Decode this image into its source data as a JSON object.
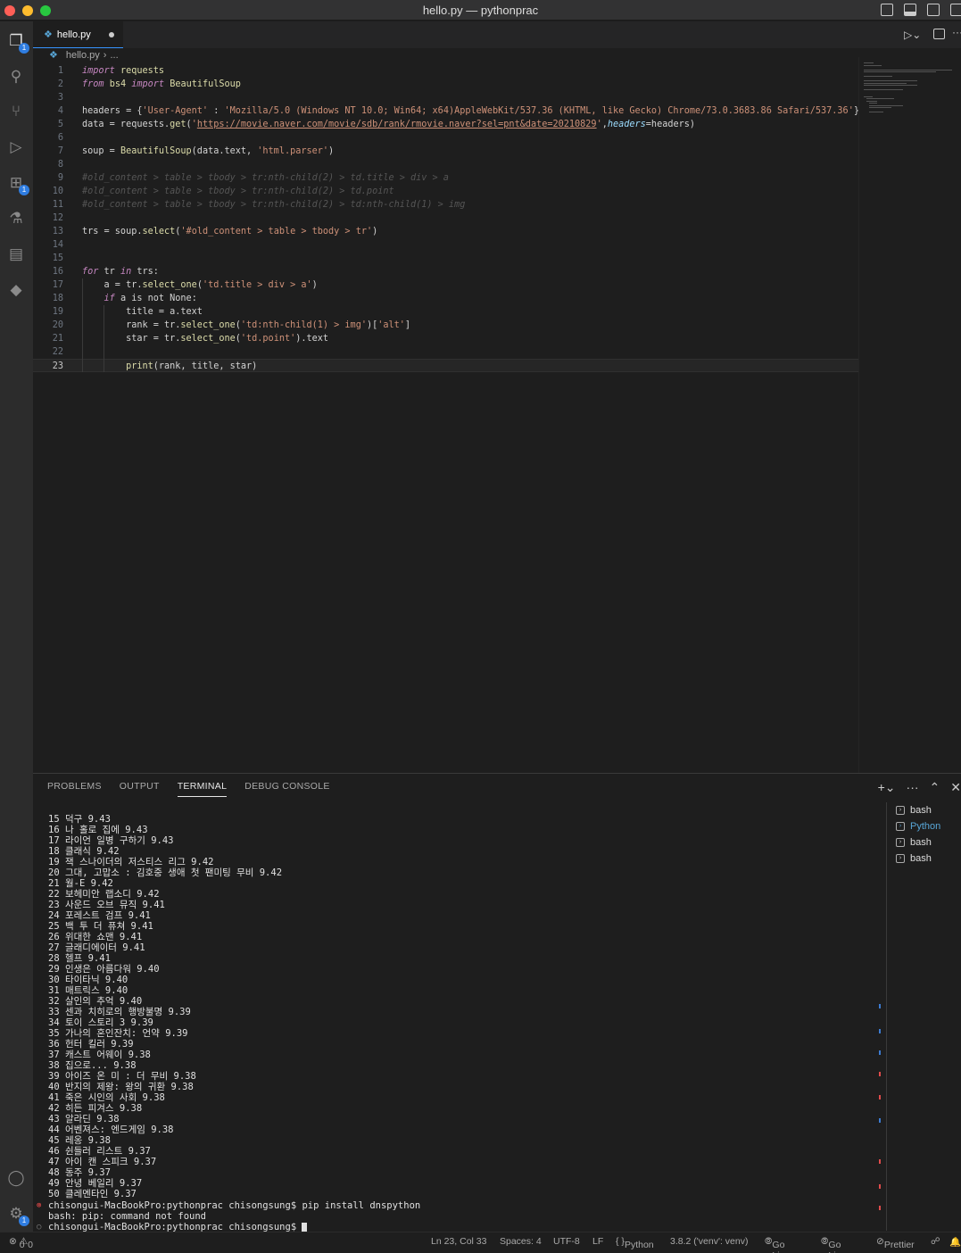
{
  "window": {
    "title": "hello.py — pythonprac"
  },
  "activity_bar": {
    "explorer_badge": "1",
    "extensions_badge": "1",
    "settings_badge": "1"
  },
  "tab": {
    "filename": "hello.py"
  },
  "breadcrumb": {
    "file": "hello.py",
    "more": "..."
  },
  "code": [
    {
      "n": "1",
      "html": "<span class='kw'>import</span> <span class='fn'>requests</span>"
    },
    {
      "n": "2",
      "html": "<span class='kw'>from</span> <span class='fn'>bs4</span> <span class='kw'>import</span> <span class='fn'>BeautifulSoup</span>"
    },
    {
      "n": "3",
      "html": ""
    },
    {
      "n": "4",
      "html": "headers = {<span class='st'>'User-Agent'</span> : <span class='st'>'Mozilla/5.0 (Windows NT 10.0; Win64; x64)AppleWebKit/537.36 (KHTML, like Gecko) Chrome/73.0.3683.86 Safari/537.36'</span>}"
    },
    {
      "n": "5",
      "html": "data = requests.<span class='fn'>get</span>(<span class='st'>'</span><span class='url'>https://movie.naver.com/movie/sdb/rank/rmovie.naver?sel=pnt&amp;date=20210829</span><span class='st'>'</span>,<span class='par'>headers</span>=headers)"
    },
    {
      "n": "6",
      "html": ""
    },
    {
      "n": "7",
      "html": "soup = <span class='fn'>BeautifulSoup</span>(data.text, <span class='st'>'html.parser'</span>)"
    },
    {
      "n": "8",
      "html": ""
    },
    {
      "n": "9",
      "html": "<span class='cm'>#old_content &gt; table &gt; tbody &gt; tr:nth-child(2) &gt; td.title &gt; div &gt; a</span>"
    },
    {
      "n": "10",
      "html": "<span class='cm'>#old_content &gt; table &gt; tbody &gt; tr:nth-child(2) &gt; td.point</span>"
    },
    {
      "n": "11",
      "html": "<span class='cm'>#old_content &gt; table &gt; tbody &gt; tr:nth-child(2) &gt; td:nth-child(1) &gt; img</span>"
    },
    {
      "n": "12",
      "html": ""
    },
    {
      "n": "13",
      "html": "trs = soup.<span class='fn'>select</span>(<span class='st'>'#old_content &gt; table &gt; tbody &gt; tr'</span>)"
    },
    {
      "n": "14",
      "html": ""
    },
    {
      "n": "15",
      "html": ""
    },
    {
      "n": "16",
      "html": "<span class='kw'>for</span> tr <span class='kw'>in</span> trs:"
    },
    {
      "n": "17",
      "html": "    a = tr.<span class='fn'>select_one</span>(<span class='st'>'td.title &gt; div &gt; a'</span>)"
    },
    {
      "n": "18",
      "html": "    <span class='kw'>if</span> a is not None:"
    },
    {
      "n": "19",
      "html": "        title = a.text"
    },
    {
      "n": "20",
      "html": "        rank = tr.<span class='fn'>select_one</span>(<span class='st'>'td:nth-child(1) &gt; img'</span>)[<span class='st'>'alt'</span>]"
    },
    {
      "n": "21",
      "html": "        star = tr.<span class='fn'>select_one</span>(<span class='st'>'td.point'</span>).text"
    },
    {
      "n": "22",
      "html": ""
    },
    {
      "n": "23",
      "html": "        <span class='fn'>print</span>(rank, title, star)"
    }
  ],
  "panel": {
    "tabs": [
      "PROBLEMS",
      "OUTPUT",
      "TERMINAL",
      "DEBUG CONSOLE"
    ],
    "active": "TERMINAL"
  },
  "terminal": {
    "lines": [
      "15 덕구 9.43",
      "16 나 홀로 집에 9.43",
      "17 라이언 일병 구하기 9.43",
      "18 클래식 9.42",
      "19 잭 스나이더의 저스티스 리그 9.42",
      "20 그대, 고맙소 : 김호중 생애 첫 팬미팅 무비 9.42",
      "21 월-E 9.42",
      "22 보헤미안 랩소디 9.42",
      "23 사운드 오브 뮤직 9.41",
      "24 포레스트 검프 9.41",
      "25 백 투 더 퓨쳐 9.41",
      "26 위대한 쇼맨 9.41",
      "27 글래디에이터 9.41",
      "28 헬프 9.41",
      "29 인생은 아름다워 9.40",
      "30 타이타닉 9.40",
      "31 매트릭스 9.40",
      "32 살인의 추억 9.40",
      "33 센과 치히로의 행방불명 9.39",
      "34 토이 스토리 3 9.39",
      "35 가나의 혼인잔치: 언약 9.39",
      "36 헌터 킬러 9.39",
      "37 캐스트 어웨이 9.38",
      "38 집으로... 9.38",
      "39 아이즈 온 미 : 더 무비 9.38",
      "40 반지의 제왕: 왕의 귀환 9.38",
      "41 죽은 시인의 사회 9.38",
      "42 히든 피겨스 9.38",
      "43 알라딘 9.38",
      "44 어벤져스: 엔드게임 9.38",
      "45 레옹 9.38",
      "46 쉰들러 리스트 9.37",
      "47 아이 캔 스피크 9.37",
      "48 동주 9.37",
      "49 안녕 베일리 9.37",
      "50 클레멘타인 9.37"
    ],
    "cmd1": "chisongui-MacBookPro:pythonprac chisongsung$ pip install dnspython",
    "error": "bash: pip: command not found",
    "prompt": "chisongui-MacBookPro:pythonprac chisongsung$ "
  },
  "terminals": [
    "bash",
    "Python",
    "bash",
    "bash"
  ],
  "statusbar": {
    "errors": "0",
    "warnings": "0",
    "position": "Ln 23, Col 33",
    "spaces": "Spaces: 4",
    "encoding": "UTF-8",
    "eol": "LF",
    "language": "Python",
    "interpreter": "3.8.2 ('venv': venv)",
    "golive1": "Go Live",
    "golive2": "Go Live",
    "prettier": "Prettier"
  }
}
